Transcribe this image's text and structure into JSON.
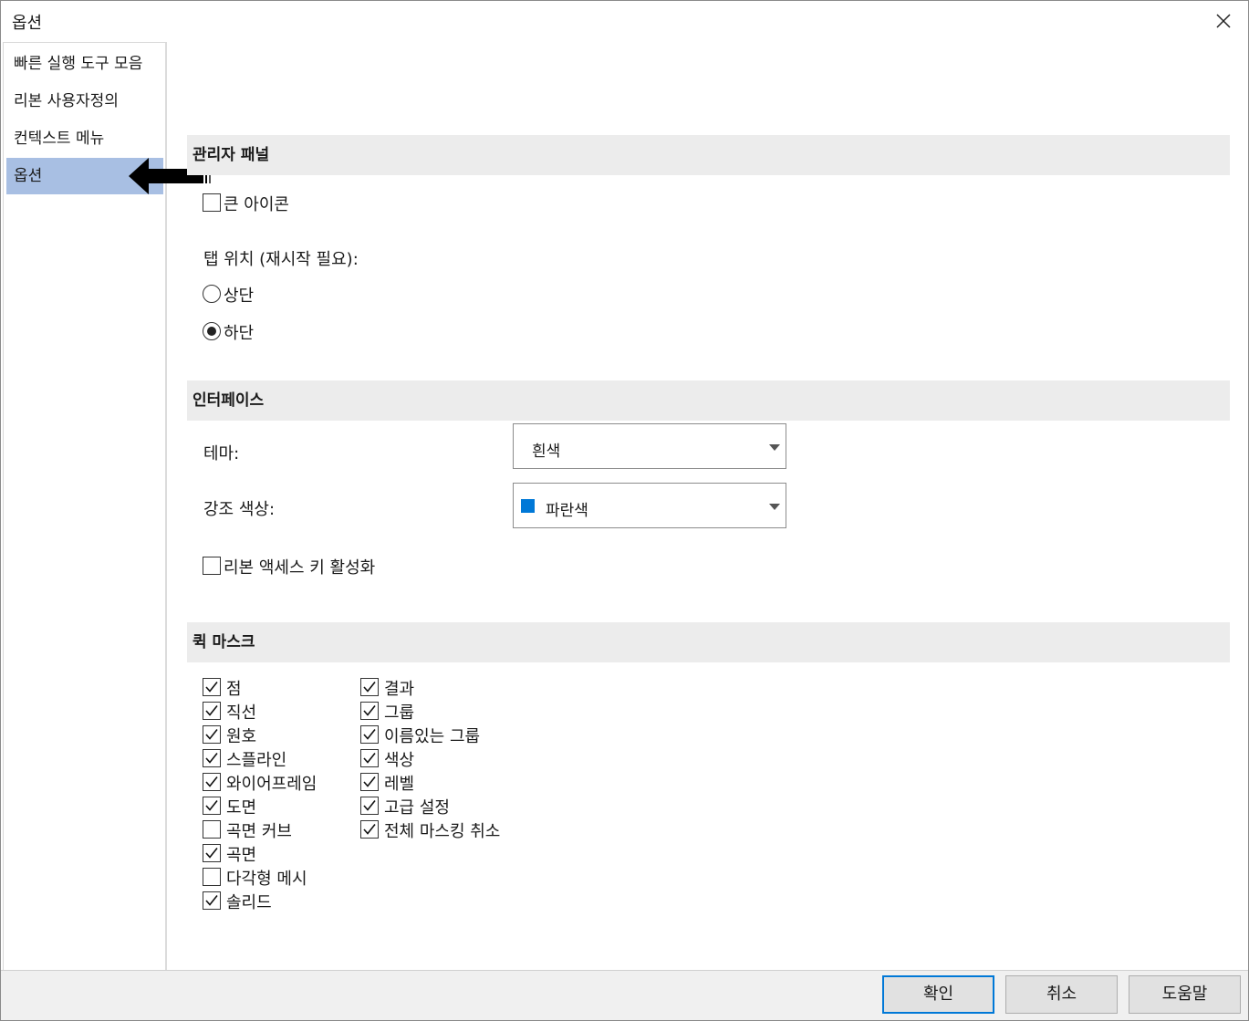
{
  "window": {
    "title": "옵션"
  },
  "sidebar": {
    "items": [
      {
        "label": "빠른 실행 도구 모음"
      },
      {
        "label": "리본 사용자정의"
      },
      {
        "label": "컨텍스트 메뉴"
      },
      {
        "label": "옵션",
        "selected": true
      }
    ]
  },
  "admin_panel": {
    "header": "관리자 패널",
    "large_icons": {
      "label": "큰 아이콘",
      "checked": false
    },
    "tab_position_label": "탭 위치 (재시작 필요):",
    "tab_top": {
      "label": "상단",
      "selected": false
    },
    "tab_bottom": {
      "label": "하단",
      "selected": true
    }
  },
  "interface": {
    "header": "인터페이스",
    "theme_label": "테마:",
    "theme_value": "흰색",
    "accent_label": "강조 색상:",
    "accent_value": "파란색",
    "accent_color": "#0078d7",
    "ribbon_keys": {
      "label": "리본 액세스 키 활성화",
      "checked": false
    }
  },
  "quick_mask": {
    "header": "퀵 마스크",
    "col1": [
      {
        "label": "점",
        "checked": true
      },
      {
        "label": "직선",
        "checked": true
      },
      {
        "label": "원호",
        "checked": true
      },
      {
        "label": "스플라인",
        "checked": true
      },
      {
        "label": "와이어프레임",
        "checked": true
      },
      {
        "label": "도면",
        "checked": true
      },
      {
        "label": "곡면 커브",
        "checked": false
      },
      {
        "label": "곡면",
        "checked": true
      },
      {
        "label": "다각형 메시",
        "checked": false
      },
      {
        "label": "솔리드",
        "checked": true
      }
    ],
    "col2": [
      {
        "label": "결과",
        "checked": true
      },
      {
        "label": "그룹",
        "checked": true
      },
      {
        "label": "이름있는 그룹",
        "checked": true
      },
      {
        "label": "색상",
        "checked": true
      },
      {
        "label": "레벨",
        "checked": true
      },
      {
        "label": "고급 설정",
        "checked": true
      },
      {
        "label": "전체 마스킹 취소",
        "checked": true
      }
    ]
  },
  "footer": {
    "ok": "확인",
    "cancel": "취소",
    "help": "도움말"
  },
  "icons": {
    "close": "close-icon",
    "checkmark": "checkmark-icon",
    "arrow": "arrow-left-icon",
    "caret": "chevron-down-icon"
  }
}
